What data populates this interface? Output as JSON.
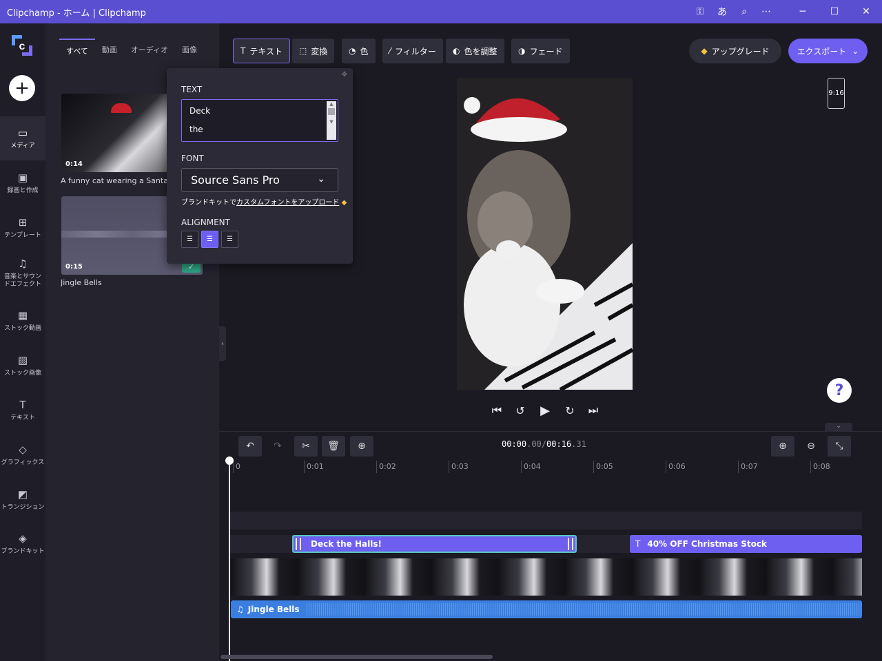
{
  "window": {
    "title": "Clipchamp - ホーム | Clipchamp"
  },
  "titlebar_icons": [
    "key-icon",
    "translate-icon",
    "zoom-icon",
    "more-icon"
  ],
  "nav": {
    "items": [
      {
        "label": "メディア",
        "icon": "folder-icon"
      },
      {
        "label": "録画と作成",
        "icon": "camera-icon"
      },
      {
        "label": "テンプレート",
        "icon": "template-icon"
      },
      {
        "label": "音楽とサウンドエフェクト",
        "icon": "music-icon"
      },
      {
        "label": "ストック動画",
        "icon": "film-icon"
      },
      {
        "label": "ストック画像",
        "icon": "image-icon"
      },
      {
        "label": "テキスト",
        "icon": "text-icon"
      },
      {
        "label": "グラフィックス",
        "icon": "shapes-icon"
      },
      {
        "label": "トランジション",
        "icon": "transition-icon"
      },
      {
        "label": "ブランドキット",
        "icon": "brand-icon"
      }
    ]
  },
  "media": {
    "tabs": [
      "すべて",
      "動画",
      "オーディオ",
      "画像"
    ],
    "items": [
      {
        "duration": "0:14",
        "label": "A funny cat wearing a Santa Cla"
      },
      {
        "duration": "0:15",
        "label": "Jingle Bells"
      }
    ]
  },
  "text_panel": {
    "text_heading": "TEXT",
    "text_lines": [
      "Deck",
      "the"
    ],
    "font_heading": "FONT",
    "font_value": "Source Sans Pro",
    "brand_prefix": "ブランドキットで",
    "brand_link": "カスタムフォントをアップロード",
    "alignment_heading": "ALIGNMENT",
    "alignment_selected": "center"
  },
  "toolbar": {
    "buttons": [
      "テキスト",
      "変換",
      "色",
      "フィルター",
      "色を調整",
      "フェード"
    ],
    "upgrade_label": "アップグレード",
    "export_label": "エクスポート"
  },
  "preview": {
    "aspect_ratio": "9:16"
  },
  "timeline": {
    "time_current_main": "00:00",
    "time_current_frac": ".00",
    "time_sep": "/",
    "time_total_main": "00:16",
    "time_total_frac": ".31",
    "ruler_labels": [
      "0",
      "0:01",
      "0:02",
      "0:03",
      "0:04",
      "0:05",
      "0:06",
      "0:07",
      "0:08"
    ],
    "text_clips": [
      "Deck the Halls!",
      "40% OFF Christmas Stock"
    ],
    "audio_clip": "Jingle Bells"
  },
  "colors": {
    "accent": "#6e5ff0",
    "titlebar": "#5b4fd1",
    "audio": "#3a7fe0",
    "check": "#2fa585"
  }
}
